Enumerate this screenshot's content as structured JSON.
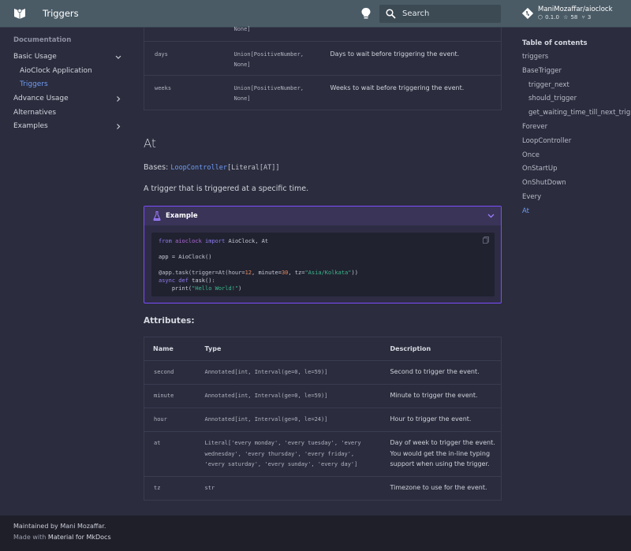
{
  "header": {
    "title": "Triggers",
    "search_placeholder": "Search",
    "repo": {
      "name": "ManiMozaffar/aioclock",
      "version": "0.1.0",
      "stars": "58",
      "forks": "3"
    }
  },
  "nav": {
    "title": "Documentation",
    "items": [
      {
        "label": "Basic Usage",
        "chevron": "down"
      },
      {
        "label": "AioClock Application"
      },
      {
        "label": "Triggers"
      },
      {
        "label": "Advance Usage",
        "chevron": "right"
      },
      {
        "label": "Alternatives"
      },
      {
        "label": "Examples",
        "chevron": "right"
      }
    ]
  },
  "toc": {
    "title": "Table of contents",
    "items": [
      {
        "label": "triggers"
      },
      {
        "label": "BaseTrigger"
      },
      {
        "label": "trigger_next"
      },
      {
        "label": "should_trigger"
      },
      {
        "label": "get_waiting_time_till_next_trig..."
      },
      {
        "label": "Forever"
      },
      {
        "label": "LoopController"
      },
      {
        "label": "Once"
      },
      {
        "label": "OnStartUp"
      },
      {
        "label": "OnShutDown"
      },
      {
        "label": "Every"
      },
      {
        "label": "At"
      }
    ]
  },
  "top_table": {
    "partial_type": "None]",
    "rows": [
      {
        "name": "days",
        "type1": "Union[PositiveNumber,",
        "type2": "None]",
        "desc": "Days to wait before triggering the event."
      },
      {
        "name": "weeks",
        "type1": "Union[PositiveNumber,",
        "type2": "None]",
        "desc": "Weeks to wait before triggering the event."
      }
    ]
  },
  "section": {
    "heading": "At",
    "bases_label": "Bases:",
    "bases_link": "LoopController",
    "bases_rest": "[Literal[AT]]",
    "lead": "A trigger that is triggered at a specific time."
  },
  "example": {
    "title": "Example",
    "code": {
      "l1_kw1": "from",
      "l1_mod": "aioclock",
      "l1_kw2": "import",
      "l1_rest": "AioClock, At",
      "l2": "app = AioClock()",
      "l3_a": "@app.task(trigger=At(hour=",
      "l3_n1": "12",
      "l3_b": ", minute=",
      "l3_n2": "30",
      "l3_c": ", tz=",
      "l3_s": "\"Asia/Kolkata\"",
      "l3_d": "))",
      "l4_kw": "async def",
      "l4_fn": "task",
      "l4_rest": "():",
      "l5_a": "    print(",
      "l5_s": "\"Hello World!\"",
      "l5_b": ")"
    }
  },
  "attributes": {
    "title": "Attributes:",
    "columns": [
      "Name",
      "Type",
      "Description"
    ],
    "rows": [
      {
        "name": "second",
        "type": [
          "Annotated[int, Interval(ge=0, le=59)]"
        ],
        "desc": [
          "Second to trigger the event."
        ]
      },
      {
        "name": "minute",
        "type": [
          "Annotated[int, Interval(ge=0, le=59)]"
        ],
        "desc": [
          "Minute to trigger the event."
        ]
      },
      {
        "name": "hour",
        "type": [
          "Annotated[int, Interval(ge=0, le=24)]"
        ],
        "desc": [
          "Hour to trigger the event."
        ]
      },
      {
        "name": "at",
        "type": [
          "Literal['every monday', 'every tuesday', 'every",
          "wednesday', 'every thursday', 'every friday',",
          "'every saturday', 'every sunday', 'every day']"
        ],
        "desc": [
          "Day of week to trigger the event.",
          "You would get the in-line typing",
          "support when using the trigger."
        ]
      },
      {
        "name": "tz",
        "type": [
          "str"
        ],
        "desc": [
          "Timezone to use for the event."
        ]
      }
    ]
  },
  "footer": {
    "line1": "Maintained by Mani Mozaffar.",
    "made_with": "Made with",
    "made_link": "Material for MkDocs"
  }
}
